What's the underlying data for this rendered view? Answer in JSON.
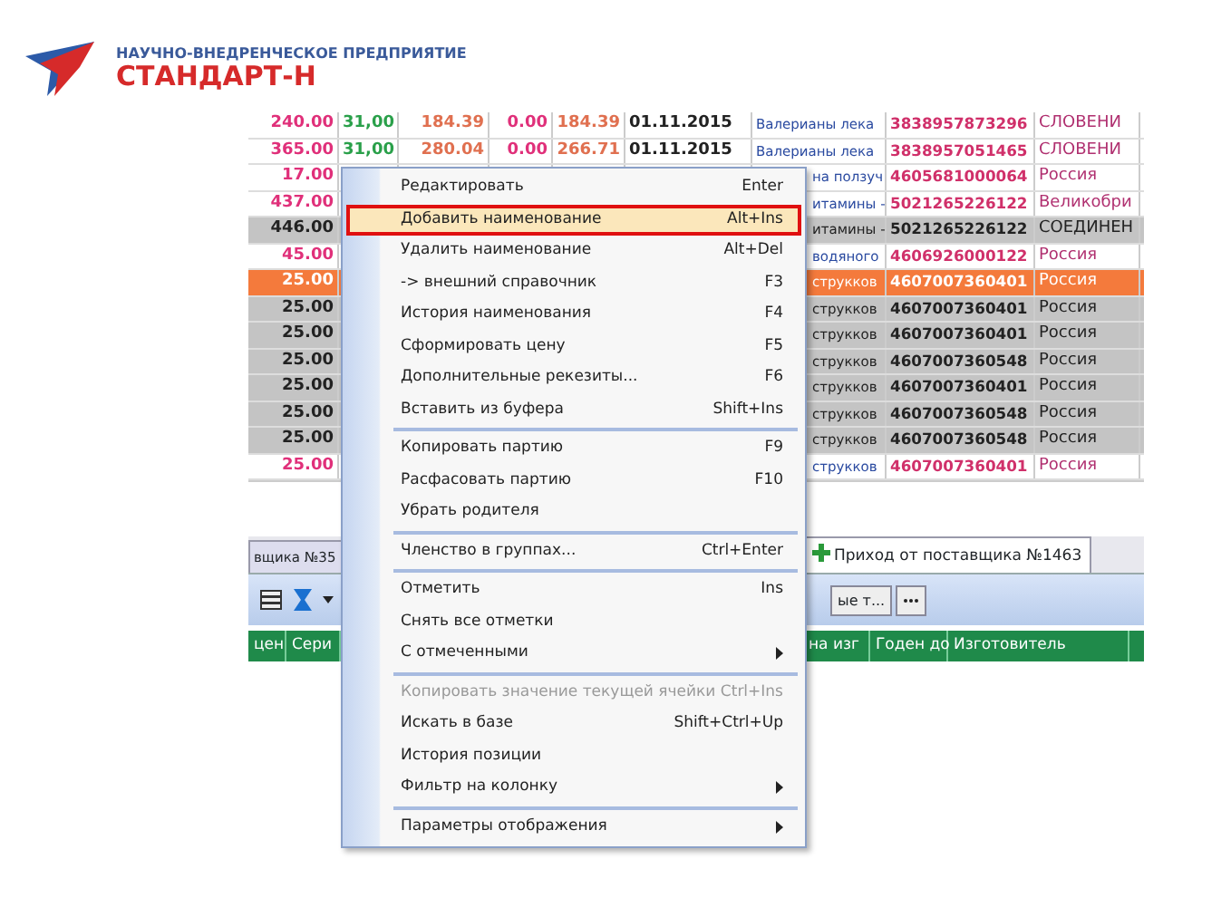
{
  "logo": {
    "subtitle": "НАУЧНО-ВНЕДРЕНЧЕСКОЕ ПРЕДПРИЯТИЕ",
    "name": "СТАНДАРТ-Н"
  },
  "table": {
    "rows": [
      {
        "marked": false,
        "current": false,
        "price": "240.00",
        "col_2": "31,00",
        "col_3": "184.39",
        "col_4": "0.00",
        "col_5": "184.39",
        "date": "01.11.2015",
        "name": "Валерианы лека",
        "barcode": "3838957873296",
        "country": "СЛОВЕНИ"
      },
      {
        "marked": false,
        "current": false,
        "price": "365.00",
        "col_2": "31,00",
        "col_3": "280.04",
        "col_4": "0.00",
        "col_5": "266.71",
        "date": "01.11.2015",
        "name": "Валерианы лека",
        "barcode": "3838957051465",
        "country": "СЛОВЕНИ"
      },
      {
        "marked": false,
        "current": false,
        "price": "17.00",
        "name": "на ползуч",
        "barcode": "4605681000064",
        "country": "Россия"
      },
      {
        "marked": false,
        "current": false,
        "price": "437.00",
        "name": "итамины -",
        "barcode": "5021265226122",
        "country": "Великобри"
      },
      {
        "marked": true,
        "current": false,
        "price": "446.00",
        "name": "итамины -",
        "barcode": "5021265226122",
        "country": "СОЕДИНЕН"
      },
      {
        "marked": false,
        "current": false,
        "price": "45.00",
        "name": "водяного",
        "barcode": "4606926000122",
        "country": "Россия"
      },
      {
        "current": true,
        "price": "25.00",
        "name": "струкков",
        "barcode": "4607007360401",
        "country": "Россия"
      },
      {
        "marked": true,
        "current": false,
        "price": "25.00",
        "name": "струкков",
        "barcode": "4607007360401",
        "country": "Россия"
      },
      {
        "marked": true,
        "current": false,
        "price": "25.00",
        "name": "струкков",
        "barcode": "4607007360401",
        "country": "Россия"
      },
      {
        "marked": true,
        "current": false,
        "price": "25.00",
        "name": "струкков",
        "barcode": "4607007360548",
        "country": "Россия"
      },
      {
        "marked": true,
        "current": false,
        "price": "25.00",
        "name": "струкков",
        "barcode": "4607007360401",
        "country": "Россия"
      },
      {
        "marked": true,
        "current": false,
        "price": "25.00",
        "name": "струкков",
        "barcode": "4607007360548",
        "country": "Россия"
      },
      {
        "marked": true,
        "current": false,
        "price": "25.00",
        "name": "струкков",
        "barcode": "4607007360548",
        "country": "Россия"
      },
      {
        "marked": false,
        "current": false,
        "price": "25.00",
        "name": "струкков",
        "barcode": "4607007360401",
        "country": "Россия"
      }
    ]
  },
  "tabs": [
    {
      "label": "вщика №35",
      "selected": false
    },
    {
      "label": "Приход от поставщика №1463",
      "selected": true
    }
  ],
  "toolbar": {
    "field_text": "ые т..."
  },
  "grid_header": {
    "left_columns": [
      "цен",
      "Сери"
    ],
    "right_columns": [
      "на изг",
      "Годен до",
      "Изготовитель"
    ]
  },
  "context_menu": {
    "items": [
      {
        "kind": "item",
        "label": "Редактировать",
        "shortcut": "Enter",
        "selected": false,
        "disabled": false,
        "submenu": false
      },
      {
        "kind": "item",
        "label": "Добавить наименование",
        "shortcut": "Alt+Ins",
        "selected": true,
        "disabled": false,
        "submenu": false
      },
      {
        "kind": "item",
        "label": "Удалить наименование",
        "shortcut": "Alt+Del",
        "selected": false,
        "disabled": false,
        "submenu": false
      },
      {
        "kind": "item",
        "label": "-> внешний справочник",
        "shortcut": "F3",
        "selected": false,
        "disabled": false,
        "submenu": false
      },
      {
        "kind": "item",
        "label": "История наименования",
        "shortcut": "F4",
        "selected": false,
        "disabled": false,
        "submenu": false
      },
      {
        "kind": "item",
        "label": "Сформировать цену",
        "shortcut": "F5",
        "selected": false,
        "disabled": false,
        "submenu": false
      },
      {
        "kind": "item",
        "label": "Дополнительные рекезиты...",
        "shortcut": "F6",
        "selected": false,
        "disabled": false,
        "submenu": false
      },
      {
        "kind": "item",
        "label": "Вставить из буфера",
        "shortcut": "Shift+Ins",
        "selected": false,
        "disabled": false,
        "submenu": false
      },
      {
        "kind": "separator"
      },
      {
        "kind": "item",
        "label": "Копировать партию",
        "shortcut": "F9",
        "selected": false,
        "disabled": false,
        "submenu": false
      },
      {
        "kind": "item",
        "label": "Расфасовать партию",
        "shortcut": "F10",
        "selected": false,
        "disabled": false,
        "submenu": false
      },
      {
        "kind": "item",
        "label": "Убрать родителя",
        "selected": false,
        "disabled": false,
        "submenu": false
      },
      {
        "kind": "separator"
      },
      {
        "kind": "item",
        "label": "Членство в группах...",
        "shortcut": "Ctrl+Enter",
        "selected": false,
        "disabled": false,
        "submenu": false
      },
      {
        "kind": "separator"
      },
      {
        "kind": "item",
        "label": "Отметить",
        "shortcut": "Ins",
        "selected": false,
        "disabled": false,
        "submenu": false
      },
      {
        "kind": "item",
        "label": "Снять все отметки",
        "selected": false,
        "disabled": false,
        "submenu": false
      },
      {
        "kind": "item",
        "label": "С отмеченными",
        "selected": false,
        "disabled": false,
        "submenu": true
      },
      {
        "kind": "separator"
      },
      {
        "kind": "item",
        "label": "Копировать значение текущей ячейки",
        "shortcut": "Ctrl+Ins",
        "selected": false,
        "disabled": true,
        "submenu": false
      },
      {
        "kind": "item",
        "label": "Искать в базе",
        "shortcut": "Shift+Ctrl+Up",
        "selected": false,
        "disabled": false,
        "submenu": false
      },
      {
        "kind": "item",
        "label": "История позиции",
        "selected": false,
        "disabled": false,
        "submenu": false
      },
      {
        "kind": "item",
        "label": "Фильтр на колонку",
        "selected": false,
        "disabled": false,
        "submenu": true
      },
      {
        "kind": "separator"
      },
      {
        "kind": "item",
        "label": "Параметры отображения",
        "selected": false,
        "disabled": false,
        "submenu": true
      }
    ]
  }
}
